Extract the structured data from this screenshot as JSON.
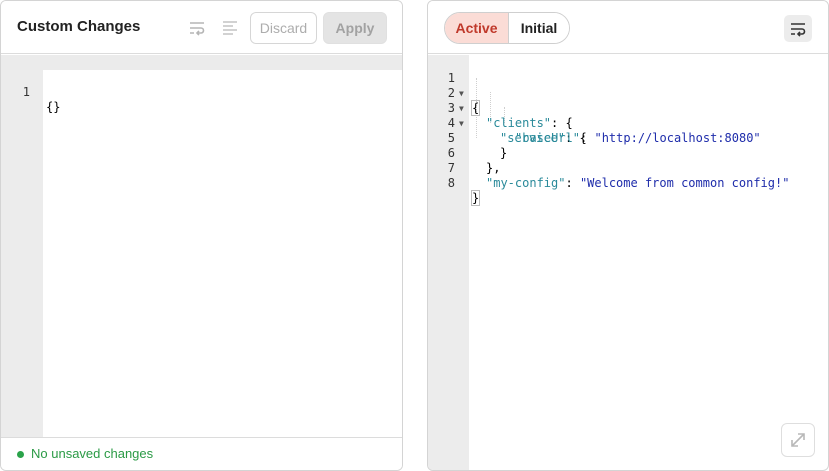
{
  "left_panel": {
    "title": "Custom Changes",
    "icons": [
      "wrap-lines-icon",
      "align-left-icon"
    ],
    "discard_label": "Discard",
    "apply_label": "Apply",
    "editor": {
      "lines": [
        {
          "num": "1",
          "text": "{}"
        }
      ]
    },
    "status": {
      "text": "No unsaved changes",
      "color": "#2aa34a"
    }
  },
  "right_panel": {
    "tabs": [
      {
        "label": "Active",
        "selected": true
      },
      {
        "label": "Initial",
        "selected": false
      }
    ],
    "wrap_icon": "wrap-lines-icon",
    "expand_icon": "expand-diagonal-icon",
    "editor": {
      "lines": [
        {
          "num": "1",
          "fold": true
        },
        {
          "num": "2",
          "fold": true
        },
        {
          "num": "3",
          "fold": true
        },
        {
          "num": "4",
          "fold": false
        },
        {
          "num": "5",
          "fold": false
        },
        {
          "num": "6",
          "fold": false
        },
        {
          "num": "7",
          "fold": false
        },
        {
          "num": "8",
          "fold": false
        }
      ],
      "json": {
        "open_brace": "{",
        "key_clients": "\"clients\"",
        "key_service": "\"service\"",
        "key_baseurl": "\"baseUrl\"",
        "val_baseurl": "\"http://localhost:8080\"",
        "key_myconfig": "\"my-config\"",
        "val_myconfig": "\"Welcome from common config!\"",
        "close_brace": "}"
      }
    }
  },
  "colors": {
    "accent_active_bg": "#fbdcd6",
    "accent_active_text": "#c0392b",
    "json_key": "#2a8a9a",
    "json_string": "#1f2dab"
  }
}
